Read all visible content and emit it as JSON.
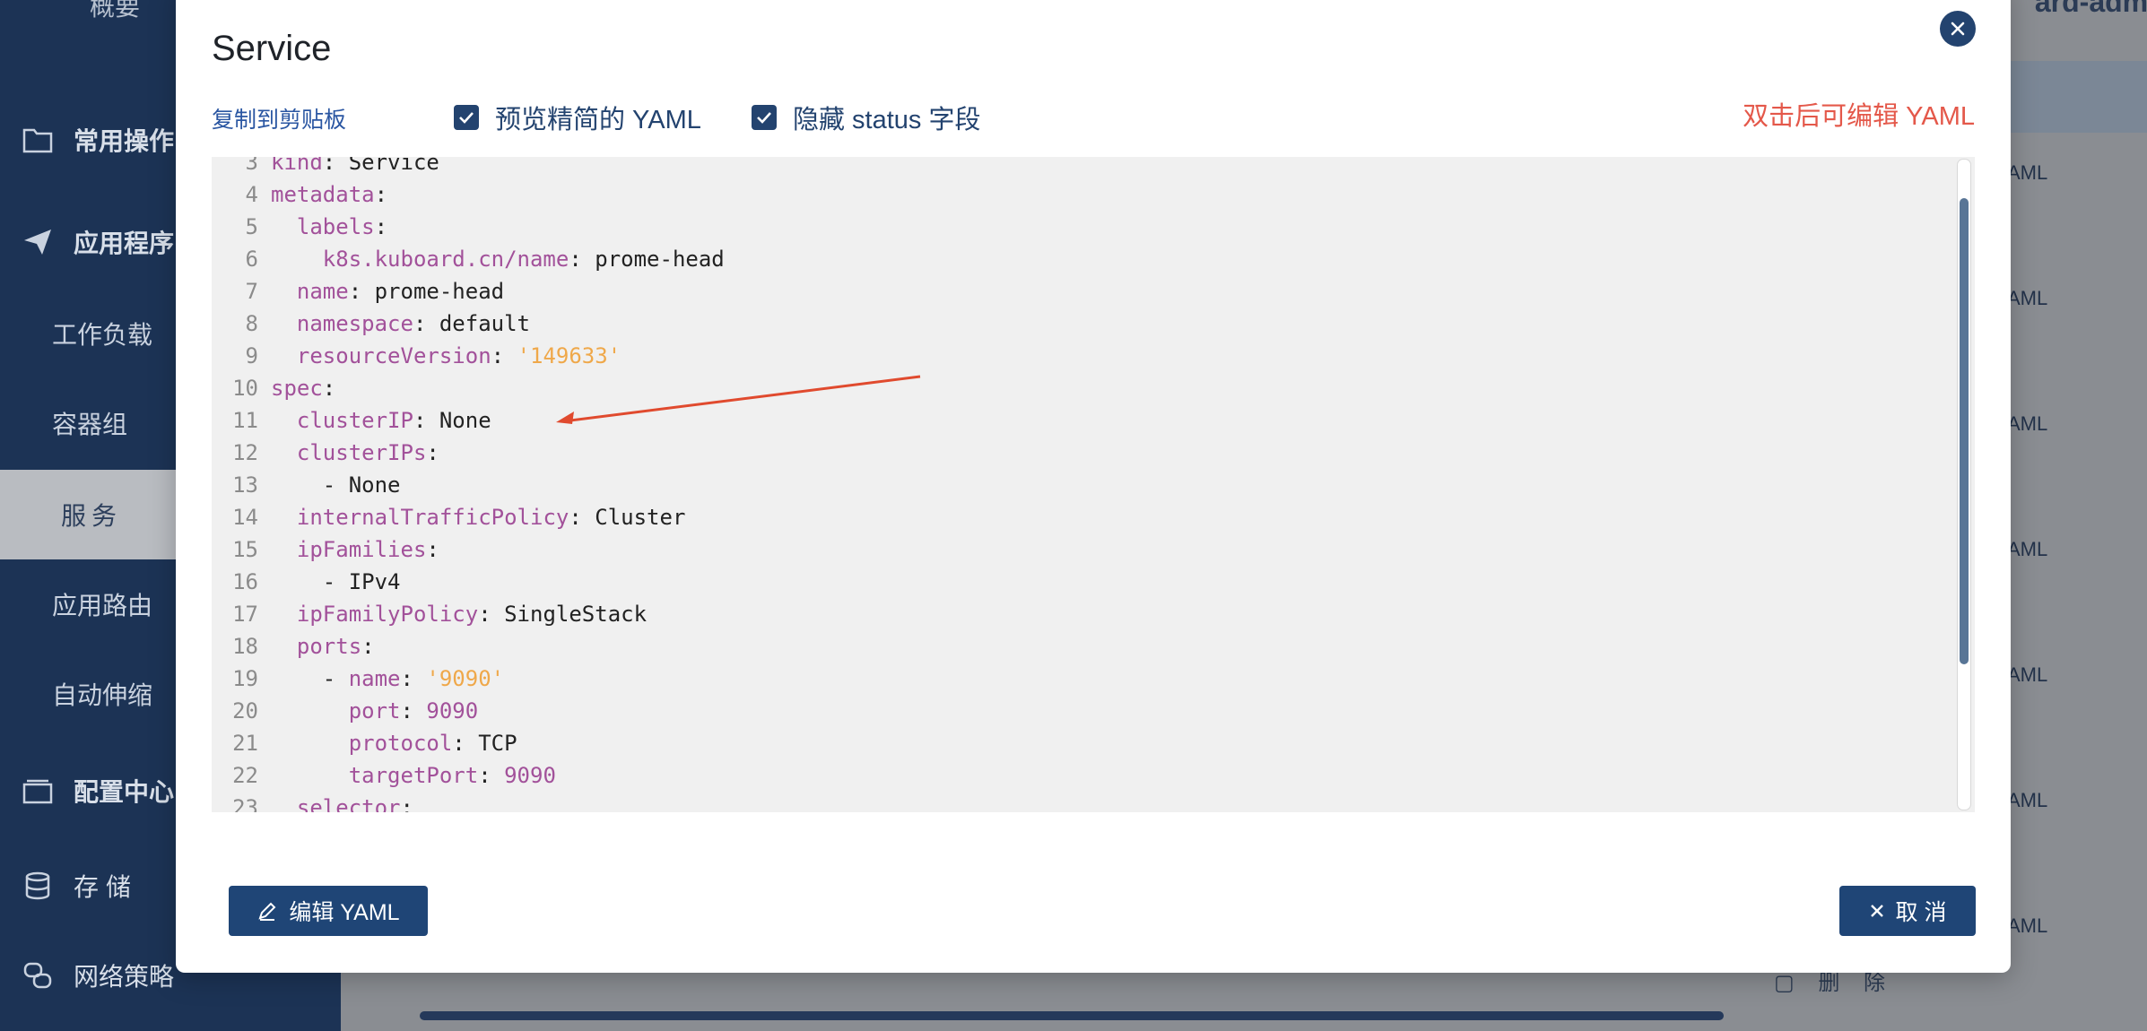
{
  "background": {
    "top_partial_text": "概要",
    "user_partial": "ard-admi",
    "sidebar": [
      {
        "label": "常用操作",
        "icon": "folder-icon",
        "type": "group"
      },
      {
        "label": "应用程序",
        "icon": "send-icon",
        "type": "group"
      },
      {
        "label": "工作负载",
        "type": "sub"
      },
      {
        "label": "容器组",
        "type": "sub"
      },
      {
        "label": "服务",
        "type": "active"
      },
      {
        "label": "应用路由",
        "type": "sub"
      },
      {
        "label": "自动伸缩",
        "type": "sub"
      },
      {
        "label": "配置中心",
        "icon": "config-icon",
        "type": "group"
      },
      {
        "label": "存储",
        "icon": "database-icon",
        "type": "group"
      },
      {
        "label": "网络策略",
        "icon": "network-icon",
        "type": "group"
      }
    ],
    "yaml_labels": [
      "AML",
      "AML",
      "AML",
      "AML",
      "AML",
      "AML",
      "AML"
    ],
    "delete_label": "删 除"
  },
  "dialog": {
    "title": "Service",
    "copy_label": "复制到剪贴板",
    "preview_label": "预览精简的 YAML",
    "hide_status_label": "隐藏 status 字段",
    "hint": "双击后可编辑 YAML",
    "edit_button": "编辑 YAML",
    "cancel_button": "取 消"
  },
  "code_lines": [
    {
      "n": "3",
      "indent": "",
      "key": "kind",
      "sep": ": ",
      "val": "Service",
      "vtype": "plain"
    },
    {
      "n": "4",
      "indent": "",
      "key": "metadata",
      "sep": ":",
      "val": "",
      "vtype": "plain"
    },
    {
      "n": "5",
      "indent": "  ",
      "key": "labels",
      "sep": ":",
      "val": "",
      "vtype": "plain"
    },
    {
      "n": "6",
      "indent": "    ",
      "key": "k8s.kuboard.cn/name",
      "sep": ": ",
      "val": "prome-head",
      "vtype": "plain"
    },
    {
      "n": "7",
      "indent": "  ",
      "key": "name",
      "sep": ": ",
      "val": "prome-head",
      "vtype": "plain"
    },
    {
      "n": "8",
      "indent": "  ",
      "key": "namespace",
      "sep": ": ",
      "val": "default",
      "vtype": "plain"
    },
    {
      "n": "9",
      "indent": "  ",
      "key": "resourceVersion",
      "sep": ": ",
      "val": "'149633'",
      "vtype": "string"
    },
    {
      "n": "10",
      "indent": "",
      "key": "spec",
      "sep": ":",
      "val": "",
      "vtype": "plain"
    },
    {
      "n": "11",
      "indent": "  ",
      "key": "clusterIP",
      "sep": ": ",
      "val": "None",
      "vtype": "plain"
    },
    {
      "n": "12",
      "indent": "  ",
      "key": "clusterIPs",
      "sep": ":",
      "val": "",
      "vtype": "plain"
    },
    {
      "n": "13",
      "indent": "    ",
      "key": "",
      "sep": "- ",
      "val": "None",
      "vtype": "plain"
    },
    {
      "n": "14",
      "indent": "  ",
      "key": "internalTrafficPolicy",
      "sep": ": ",
      "val": "Cluster",
      "vtype": "plain"
    },
    {
      "n": "15",
      "indent": "  ",
      "key": "ipFamilies",
      "sep": ":",
      "val": "",
      "vtype": "plain"
    },
    {
      "n": "16",
      "indent": "    ",
      "key": "",
      "sep": "- ",
      "val": "IPv4",
      "vtype": "plain"
    },
    {
      "n": "17",
      "indent": "  ",
      "key": "ipFamilyPolicy",
      "sep": ": ",
      "val": "SingleStack",
      "vtype": "plain"
    },
    {
      "n": "18",
      "indent": "  ",
      "key": "ports",
      "sep": ":",
      "val": "",
      "vtype": "plain"
    },
    {
      "n": "19",
      "indent": "    - ",
      "key": "name",
      "sep": ": ",
      "val": "'9090'",
      "vtype": "string"
    },
    {
      "n": "20",
      "indent": "      ",
      "key": "port",
      "sep": ": ",
      "val": "9090",
      "vtype": "number"
    },
    {
      "n": "21",
      "indent": "      ",
      "key": "protocol",
      "sep": ": ",
      "val": "TCP",
      "vtype": "plain"
    },
    {
      "n": "22",
      "indent": "      ",
      "key": "targetPort",
      "sep": ": ",
      "val": "9090",
      "vtype": "number"
    },
    {
      "n": "23",
      "indent": "  ",
      "key": "selector",
      "sep": ":",
      "val": "",
      "vtype": "plain"
    }
  ],
  "colors": {
    "primary": "#1f4576",
    "hint": "#e4584a",
    "key": "#a2519a",
    "string": "#efa84a",
    "arrow": "#e04a2e"
  }
}
